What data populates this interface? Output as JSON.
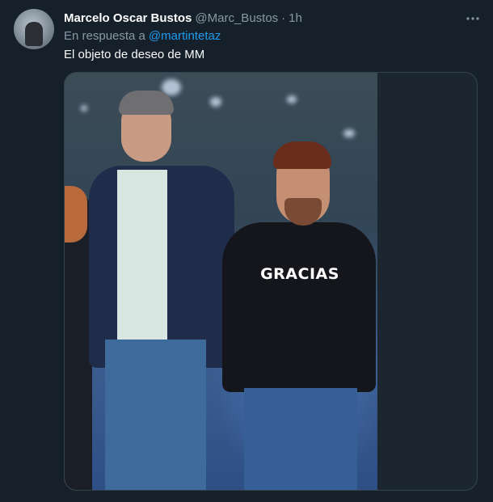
{
  "tweet": {
    "author_name": "Marcelo Oscar Bustos",
    "author_handle": "@Marc_Bustos",
    "separator": "·",
    "time": "1h",
    "reply_prefix": "En respuesta a",
    "reply_mention": "@martintetaz",
    "text": "El objeto de deseo de MM"
  },
  "media": {
    "shirt_text": "GRACIAS"
  },
  "icons": {
    "avatar": "avatar",
    "more": "more-options-icon"
  },
  "colors": {
    "background": "#15202b",
    "name": "#ffffff",
    "secondary_text": "#8b98a5",
    "link": "#1d9bf0",
    "border": "#38444d"
  }
}
